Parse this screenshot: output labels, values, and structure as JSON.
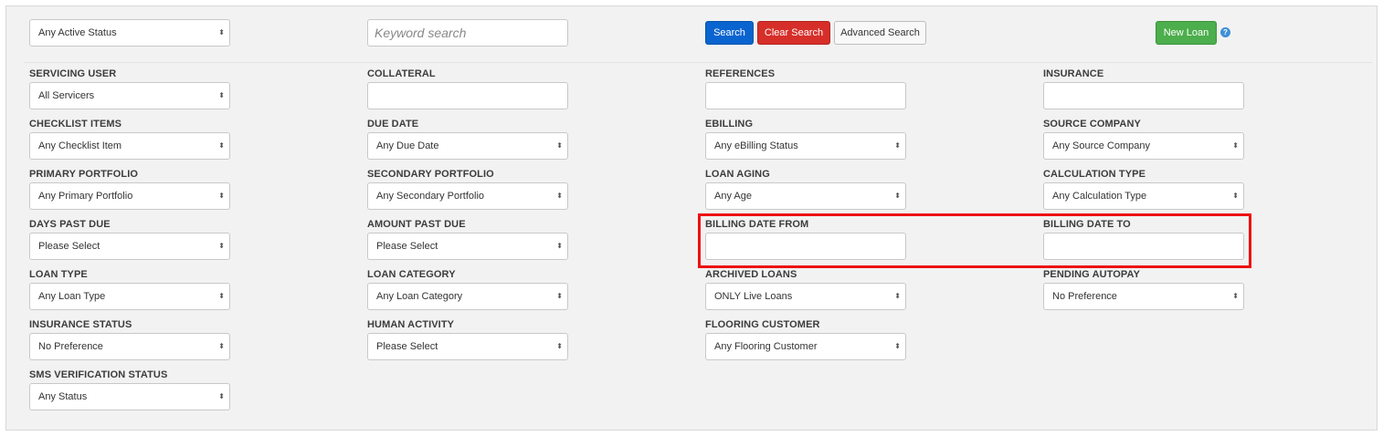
{
  "top_bar": {
    "status_select": "Any Active Status",
    "keyword_placeholder": "Keyword search",
    "search_label": "Search",
    "clear_label": "Clear Search",
    "advanced_label": "Advanced Search",
    "new_loan_label": "New Loan",
    "help_icon": "question-circle-icon"
  },
  "filters": {
    "servicing_user": {
      "label": "SERVICING USER",
      "value": "All Servicers"
    },
    "collateral": {
      "label": "COLLATERAL",
      "value": ""
    },
    "references": {
      "label": "REFERENCES",
      "value": ""
    },
    "insurance": {
      "label": "INSURANCE",
      "value": ""
    },
    "checklist_items": {
      "label": "CHECKLIST ITEMS",
      "value": "Any Checklist Item"
    },
    "due_date": {
      "label": "DUE DATE",
      "value": "Any Due Date"
    },
    "ebilling": {
      "label": "EBILLING",
      "value": "Any eBilling Status"
    },
    "source_company": {
      "label": "SOURCE COMPANY",
      "value": "Any Source Company"
    },
    "primary_portfolio": {
      "label": "PRIMARY PORTFOLIO",
      "value": "Any Primary Portfolio"
    },
    "secondary_portfolio": {
      "label": "SECONDARY PORTFOLIO",
      "value": "Any Secondary Portfolio"
    },
    "loan_aging": {
      "label": "LOAN AGING",
      "value": "Any Age"
    },
    "calculation_type": {
      "label": "CALCULATION TYPE",
      "value": "Any Calculation Type"
    },
    "days_past_due": {
      "label": "DAYS PAST DUE",
      "value": "Please Select"
    },
    "amount_past_due": {
      "label": "AMOUNT PAST DUE",
      "value": "Please Select"
    },
    "billing_date_from": {
      "label": "BILLING DATE FROM",
      "value": ""
    },
    "billing_date_to": {
      "label": "BILLING DATE TO",
      "value": ""
    },
    "loan_type": {
      "label": "LOAN TYPE",
      "value": "Any Loan Type"
    },
    "loan_category": {
      "label": "LOAN CATEGORY",
      "value": "Any Loan Category"
    },
    "archived_loans": {
      "label": "ARCHIVED LOANS",
      "value": "ONLY Live Loans"
    },
    "pending_autopay": {
      "label": "PENDING AUTOPAY",
      "value": "No Preference"
    },
    "insurance_status": {
      "label": "INSURANCE STATUS",
      "value": "No Preference"
    },
    "human_activity": {
      "label": "HUMAN ACTIVITY",
      "value": "Please Select"
    },
    "flooring_customer": {
      "label": "FLOORING CUSTOMER",
      "value": "Any Flooring Customer"
    },
    "sms_verification_status": {
      "label": "SMS VERIFICATION STATUS",
      "value": "Any Status"
    }
  },
  "colors": {
    "search_blue": "#0a64cf",
    "clear_red": "#d62f2a",
    "new_green": "#4cae4c",
    "highlight_red": "#ee1111"
  }
}
